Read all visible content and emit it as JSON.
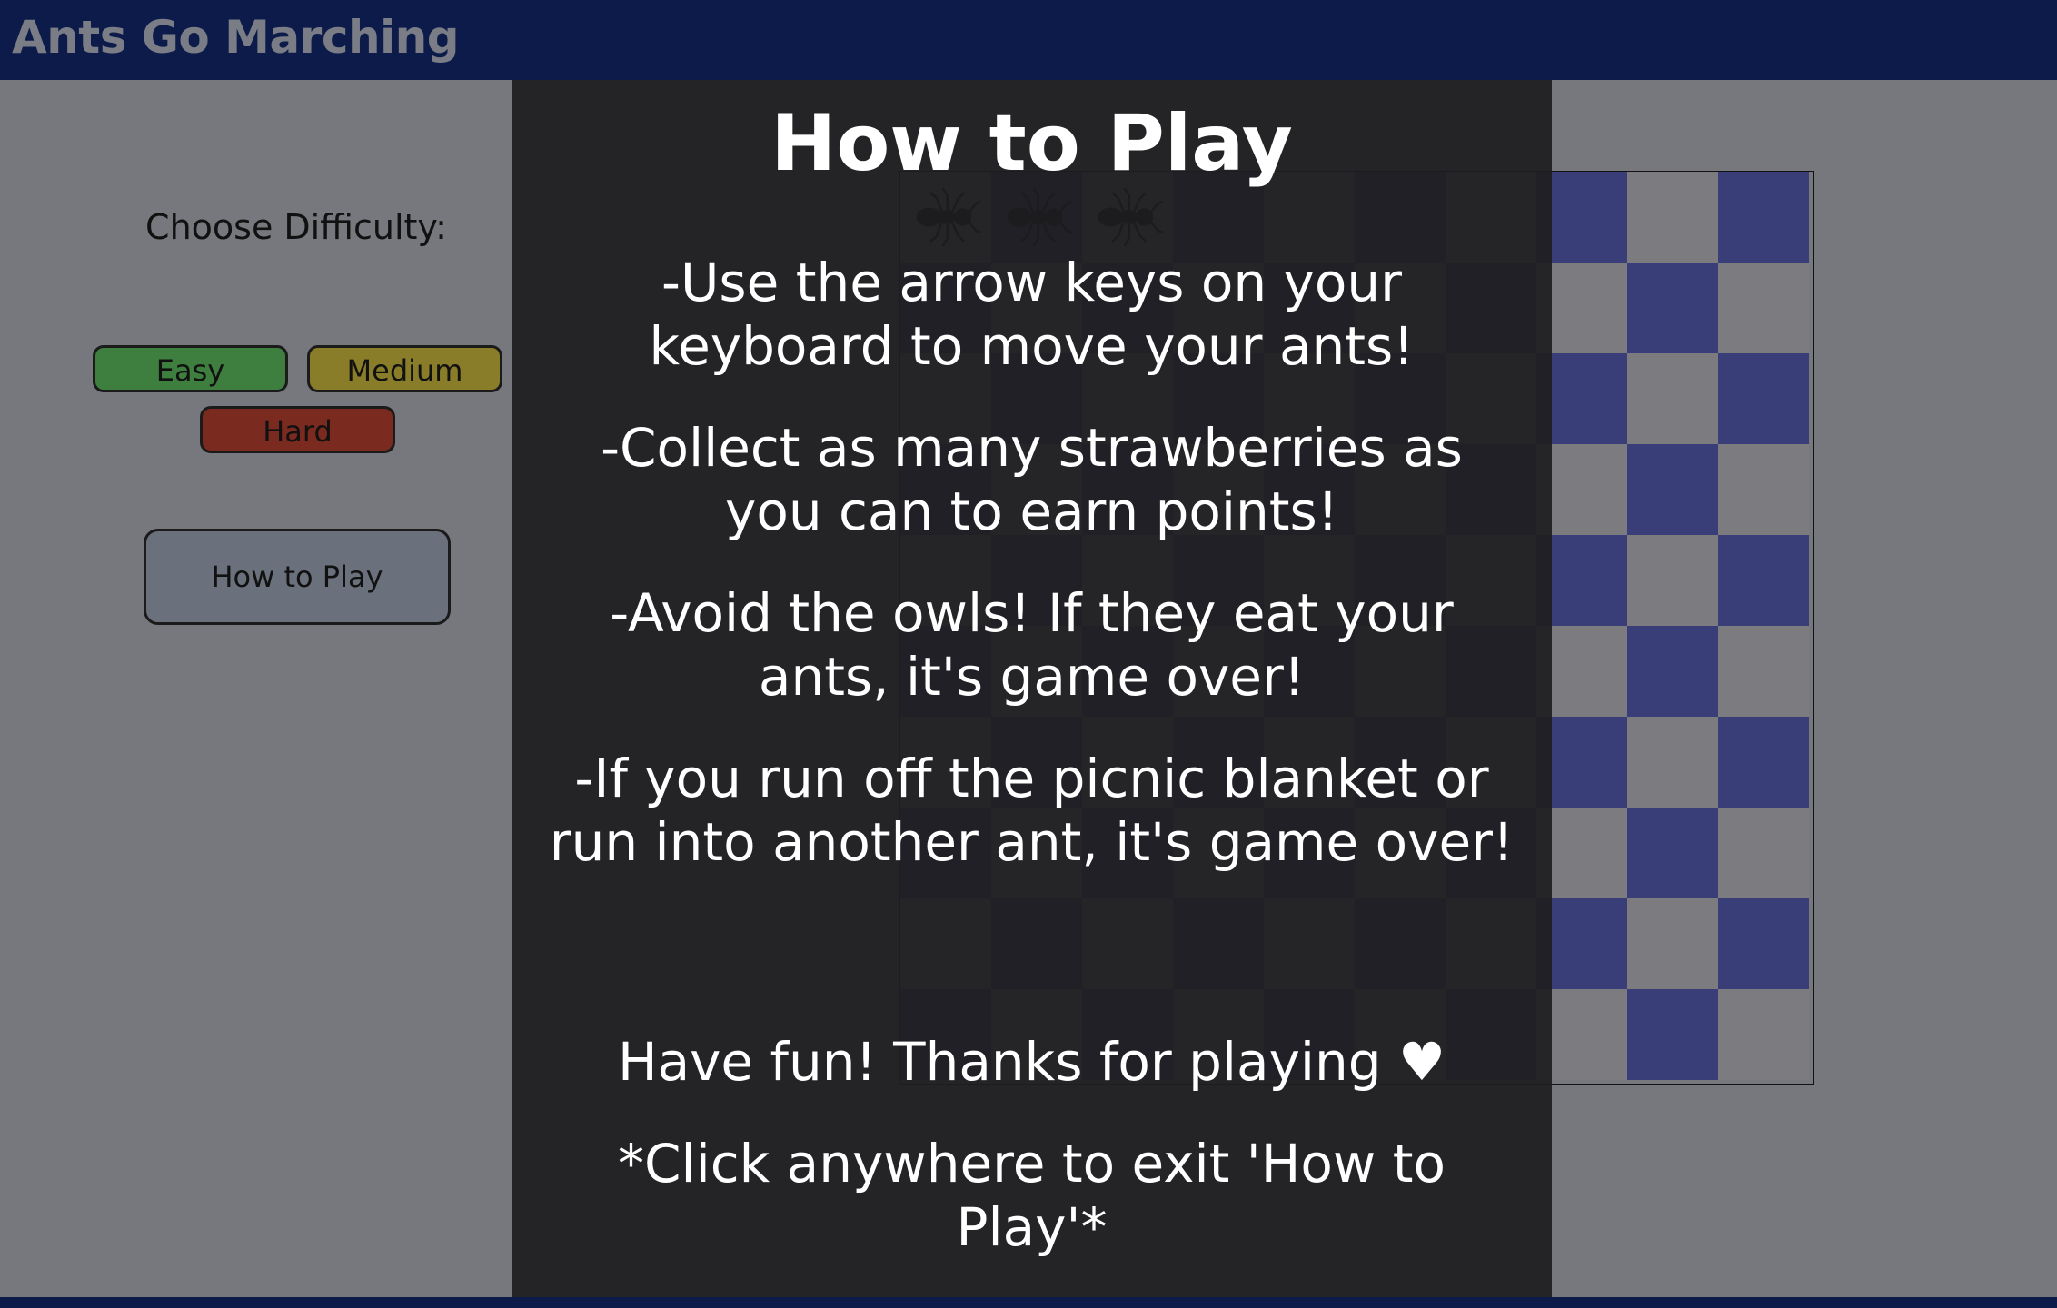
{
  "app": {
    "title": "Ants Go Marching"
  },
  "sidebar": {
    "difficulty_label": "Choose Difficulty:",
    "buttons": {
      "easy": "Easy",
      "medium": "Medium",
      "hard": "Hard"
    },
    "how_to_play_button": "How to Play"
  },
  "board": {
    "rows": 10,
    "columns": 10,
    "dark_color": "#393e78",
    "light_color": "#7c7c80",
    "ants": [
      {
        "row": 0,
        "col": 0,
        "icon": "ant-icon"
      },
      {
        "row": 0,
        "col": 1,
        "icon": "ant-icon"
      },
      {
        "row": 0,
        "col": 2,
        "icon": "ant-icon"
      }
    ]
  },
  "modal": {
    "title": "How to Play",
    "instructions": [
      "-Use the arrow keys on your keyboard to move your ants!",
      "-Collect as many strawberries as you can to earn points!",
      "-Avoid the owls! If they eat your ants, it's game over!",
      "-If you run off the picnic blanket or run into another ant, it's game over!"
    ],
    "closing": "Have fun! Thanks for playing ♥",
    "exit_hint": "*Click anywhere to exit 'How to Play'*"
  },
  "colors": {
    "header_bg": "#0c1b4a",
    "page_bg": "#76787d",
    "easy": "#3e7f3f",
    "medium": "#8a7d2a",
    "hard": "#7a2a1e",
    "modal_bg": "#1e1e20"
  }
}
